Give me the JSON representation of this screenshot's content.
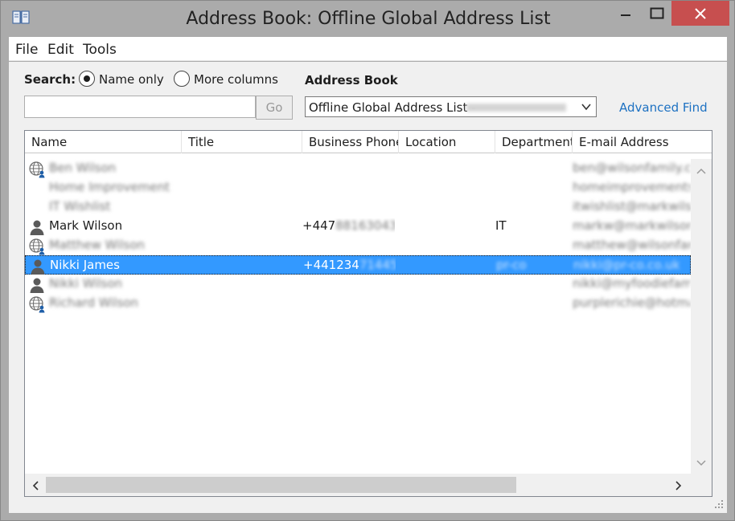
{
  "window": {
    "title": "Address Book: Offline Global Address List"
  },
  "menu": {
    "file": "File",
    "edit": "Edit",
    "tools": "Tools"
  },
  "search": {
    "label": "Search:",
    "option_name_only": "Name only",
    "option_more_columns": "More columns",
    "selected_option": "Name only",
    "input_value": "",
    "go_label": "Go"
  },
  "address_book": {
    "label": "Address Book",
    "selected": "Offline Global Address List - ",
    "advanced_find": "Advanced Find"
  },
  "columns": [
    "Name",
    "Title",
    "Business Phone",
    "Location",
    "Department",
    "E-mail Address"
  ],
  "rows": [
    {
      "icon": "globe-contact-icon",
      "name": "Ben Wilson",
      "phone": "",
      "dept": "",
      "email": "ben@wilsonfamily.co",
      "blurred": true,
      "selected": false
    },
    {
      "icon": "",
      "name": "Home Improvements",
      "phone": "",
      "dept": "",
      "email": "homeimprovements",
      "blurred": true,
      "selected": false
    },
    {
      "icon": "",
      "name": "IT Wishlist",
      "phone": "",
      "dept": "",
      "email": "itwishlist@markwilsc",
      "blurred": true,
      "selected": false
    },
    {
      "icon": "person-icon",
      "name": "Mark Wilson",
      "phone_prefix": "+447",
      "phone_rest": "88163043",
      "dept": "IT",
      "email": "markw@markwilson",
      "blurred": false,
      "selected": false
    },
    {
      "icon": "globe-contact-icon",
      "name": "Matthew Wilson",
      "phone": "",
      "dept": "",
      "email": "matthew@wilsonfan",
      "blurred": true,
      "selected": false
    },
    {
      "icon": "person-icon",
      "name": "Nikki James",
      "phone_prefix": "+441234",
      "phone_rest": "71445",
      "dept": "pr-co",
      "email": "nikki@pr-co.co.uk",
      "blurred": false,
      "selected": true
    },
    {
      "icon": "person-icon",
      "name": "Nikki Wilson",
      "phone": "",
      "dept": "",
      "email": "nikki@myfoodiefami",
      "blurred": true,
      "selected": false
    },
    {
      "icon": "globe-contact-icon",
      "name": "Richard Wilson",
      "phone": "",
      "dept": "",
      "email": "purplerichie@hotmai",
      "blurred": true,
      "selected": false
    }
  ]
}
